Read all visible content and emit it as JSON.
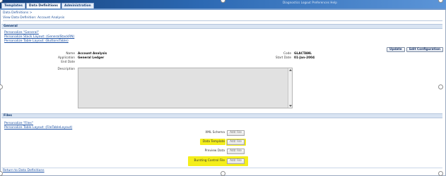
{
  "tabs": [
    {
      "label": "Templates",
      "active": false
    },
    {
      "label": "Data Definitions",
      "active": true
    },
    {
      "label": "Administration",
      "active": false
    }
  ],
  "topbar_links": "Diagnostics    Logout    Preferences    Help",
  "breadcrumb": "Data Definitions  >",
  "page_title": "View Data Definition: Account Analysis",
  "general": {
    "header": "General",
    "links": [
      "Personalize \"General\"",
      "Personalize Stack Layout: (GeneralStackRN)",
      "Personalize Table Layout: (ButtonsTable)"
    ],
    "buttons": {
      "update": "Update",
      "edit_configuration": "Edit Configuration"
    },
    "fields": {
      "name_label": "Name",
      "name_value": "Account Analysis",
      "application_label": "Application",
      "application_value": "General Ledger",
      "end_date_label": "End Date",
      "end_date_value": "",
      "code_label": "Code",
      "code_value": "GLACTANL",
      "start_date_label": "Start Date",
      "start_date_value": "01-Jan-2004",
      "description_label": "Description",
      "description_value": ""
    }
  },
  "files": {
    "header": "Files",
    "links": [
      "Personalize \"Files\"",
      "Personalize Table Layout: (FileTableLayout)"
    ],
    "rows": [
      {
        "label": "XML Schema",
        "button": "Add File",
        "highlighted": false
      },
      {
        "label": "Data Template",
        "button": "Add File",
        "highlighted": true
      },
      {
        "label": "Preview Data",
        "button": "Add File",
        "highlighted": false
      },
      {
        "label": "Bursting Control File",
        "button": "Add File",
        "highlighted": true
      }
    ]
  },
  "return_link": "Return to Data Definitions",
  "colors": {
    "highlight": "#f4ee1b",
    "brand": "#2c69b3"
  }
}
